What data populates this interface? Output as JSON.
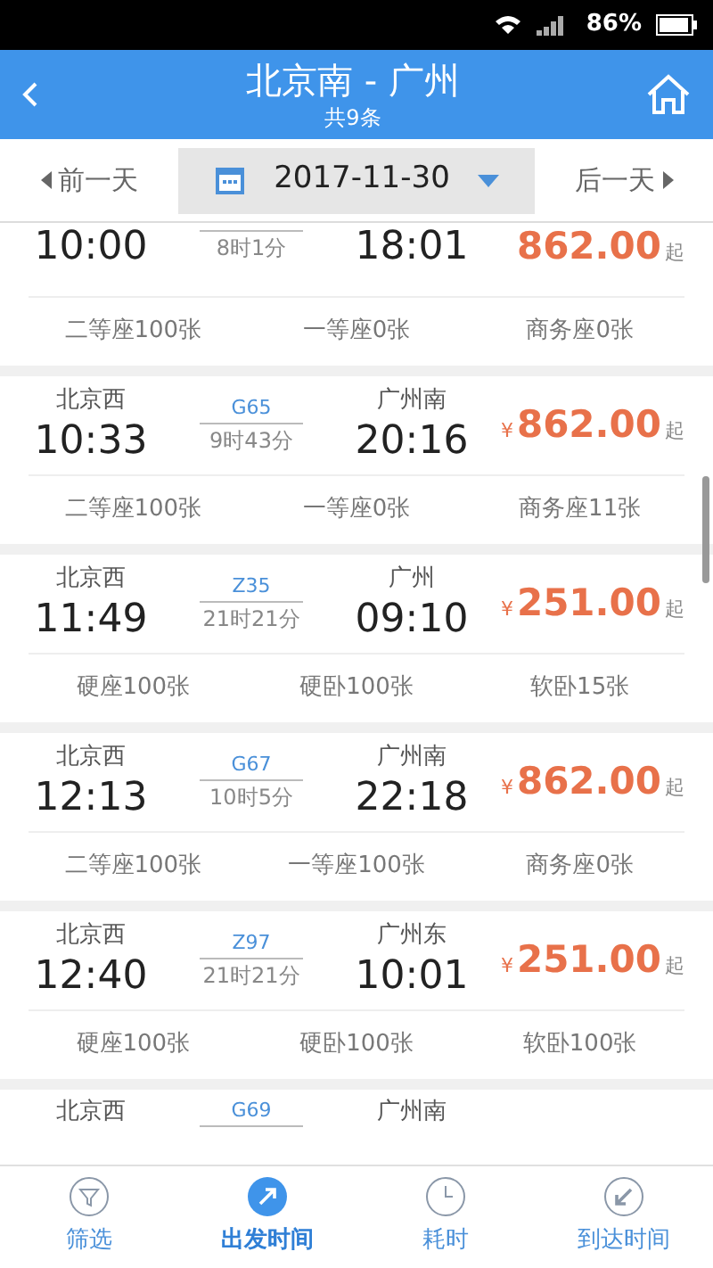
{
  "status_bar": {
    "battery": "86%"
  },
  "header": {
    "title": "北京南 - 广州",
    "subtitle": "共9条"
  },
  "date_bar": {
    "prev": "前一天",
    "date": "2017-11-30",
    "next": "后一天"
  },
  "trains": [
    {
      "depart_time": "10:00",
      "duration": "8时1分",
      "arrive_time": "18:01",
      "price": "862.00",
      "price_suffix": "起",
      "seats": [
        "二等座100张",
        "一等座0张",
        "商务座0张"
      ]
    },
    {
      "from": "北京西",
      "train_no": "G65",
      "depart_time": "10:33",
      "duration": "9时43分",
      "to": "广州南",
      "arrive_time": "20:16",
      "currency": "¥",
      "price": "862.00",
      "price_suffix": "起",
      "seats": [
        "二等座100张",
        "一等座0张",
        "商务座11张"
      ]
    },
    {
      "from": "北京西",
      "train_no": "Z35",
      "depart_time": "11:49",
      "duration": "21时21分",
      "to": "广州",
      "arrive_time": "09:10",
      "currency": "¥",
      "price": "251.00",
      "price_suffix": "起",
      "seats": [
        "硬座100张",
        "硬卧100张",
        "软卧15张"
      ]
    },
    {
      "from": "北京西",
      "train_no": "G67",
      "depart_time": "12:13",
      "duration": "10时5分",
      "to": "广州南",
      "arrive_time": "22:18",
      "currency": "¥",
      "price": "862.00",
      "price_suffix": "起",
      "seats": [
        "二等座100张",
        "一等座100张",
        "商务座0张"
      ]
    },
    {
      "from": "北京西",
      "train_no": "Z97",
      "depart_time": "12:40",
      "duration": "21时21分",
      "to": "广州东",
      "arrive_time": "10:01",
      "currency": "¥",
      "price": "251.00",
      "price_suffix": "起",
      "seats": [
        "硬座100张",
        "硬卧100张",
        "软卧100张"
      ]
    },
    {
      "from": "北京西",
      "train_no": "G69",
      "to": "广州南"
    }
  ],
  "tabs": [
    {
      "kind": "filter",
      "label": "筛选",
      "selected": false
    },
    {
      "kind": "depart",
      "label": "出发时间",
      "selected": true
    },
    {
      "kind": "duration",
      "label": "耗时",
      "selected": false
    },
    {
      "kind": "arrive",
      "label": "到达时间",
      "selected": false
    }
  ]
}
